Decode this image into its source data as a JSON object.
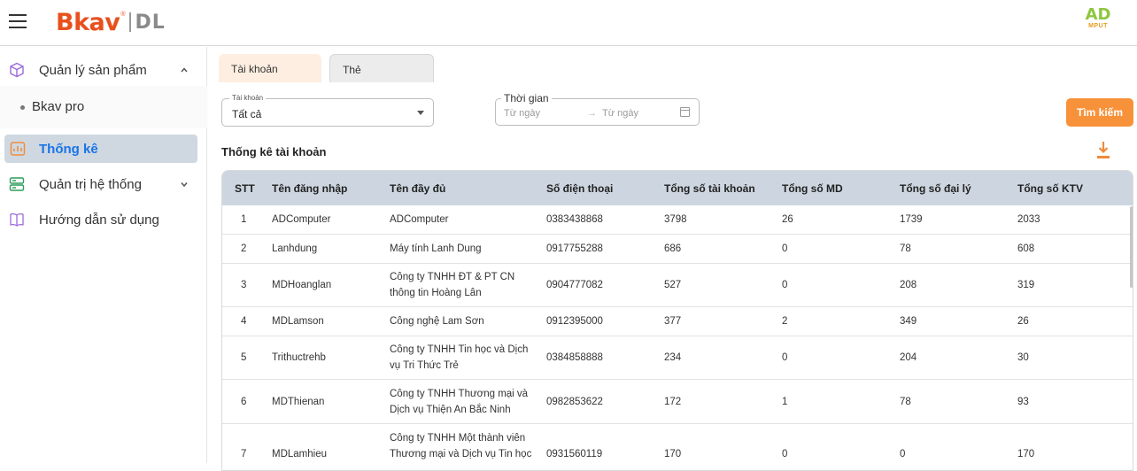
{
  "header": {
    "logo_main": "Bkav",
    "logo_reg": "®",
    "logo_sub": "DL",
    "brand_right_top": "AD",
    "brand_right_bottom": "MPUT"
  },
  "sidebar": {
    "items": [
      {
        "label": "Quản lý sản phẩm",
        "icon": "box-icon",
        "expanded": true
      },
      {
        "label": "Bkav pro",
        "sub": true
      },
      {
        "label": "Thống kê",
        "icon": "chart-icon",
        "active": true
      },
      {
        "label": "Quản trị hệ thống",
        "icon": "server-icon",
        "expanded": false
      },
      {
        "label": "Hướng dẫn sử dụng",
        "icon": "book-icon"
      }
    ]
  },
  "tabs": [
    {
      "label": "Tài khoản",
      "active": true
    },
    {
      "label": "Thẻ",
      "active": false
    }
  ],
  "filters": {
    "account_legend": "Tài khoản",
    "account_value": "Tất cả",
    "time_legend": "Thời gian",
    "from_placeholder": "Từ ngày",
    "arrow": "→",
    "to_placeholder": "Từ ngày",
    "search_label": "Tìm kiếm"
  },
  "section_title": "Thống kê tài khoản",
  "table": {
    "headers": [
      "STT",
      "Tên đăng nhập",
      "Tên đầy đủ",
      "Số điện thoại",
      "Tổng số tài khoản",
      "Tổng số MD",
      "Tổng số đại lý",
      "Tổng số KTV"
    ],
    "rows": [
      {
        "stt": "1",
        "username": "ADComputer",
        "fullname_1": "ADComputer",
        "fullname_2": "",
        "phone": "0383438868",
        "total_accounts": "3798",
        "total_md": "26",
        "total_agents": "1739",
        "total_ktv": "2033"
      },
      {
        "stt": "2",
        "username": "Lanhdung",
        "fullname_1": "Máy tính Lanh Dung",
        "fullname_2": "",
        "phone": "0917755288",
        "total_accounts": "686",
        "total_md": "0",
        "total_agents": "78",
        "total_ktv": "608"
      },
      {
        "stt": "3",
        "username": "MDHoanglan",
        "fullname_1": "Công ty TNHH ĐT & PT CN",
        "fullname_2": "thông tin Hoàng Lân",
        "phone": "0904777082",
        "total_accounts": "527",
        "total_md": "0",
        "total_agents": "208",
        "total_ktv": "319"
      },
      {
        "stt": "4",
        "username": "MDLamson",
        "fullname_1": "Công nghệ Lam Sơn",
        "fullname_2": "",
        "phone": "0912395000",
        "total_accounts": "377",
        "total_md": "2",
        "total_agents": "349",
        "total_ktv": "26"
      },
      {
        "stt": "5",
        "username": "Trithuctrehb",
        "fullname_1": "Công ty TNHH Tin học và Dịch",
        "fullname_2": "vụ Tri Thức Trẻ",
        "phone": "0384858888",
        "total_accounts": "234",
        "total_md": "0",
        "total_agents": "204",
        "total_ktv": "30"
      },
      {
        "stt": "6",
        "username": "MDThienan",
        "fullname_1": "Công ty TNHH Thương mại và",
        "fullname_2": "Dịch vụ Thiện An Bắc Ninh",
        "phone": "0982853622",
        "total_accounts": "172",
        "total_md": "1",
        "total_agents": "78",
        "total_ktv": "93"
      },
      {
        "stt": "7",
        "username": "MDLamhieu",
        "fullname_1": "Công ty TNHH Một thành viên",
        "fullname_2": "Thương mại và Dịch vụ Tin học",
        "phone": "0931560119",
        "total_accounts": "170",
        "total_md": "0",
        "total_agents": "0",
        "total_ktv": "170"
      }
    ]
  },
  "colors": {
    "brand_orange": "#e8501d",
    "accent_orange": "#f7923a",
    "active_blue": "#1a73e8",
    "header_row": "#cdd6e0"
  }
}
